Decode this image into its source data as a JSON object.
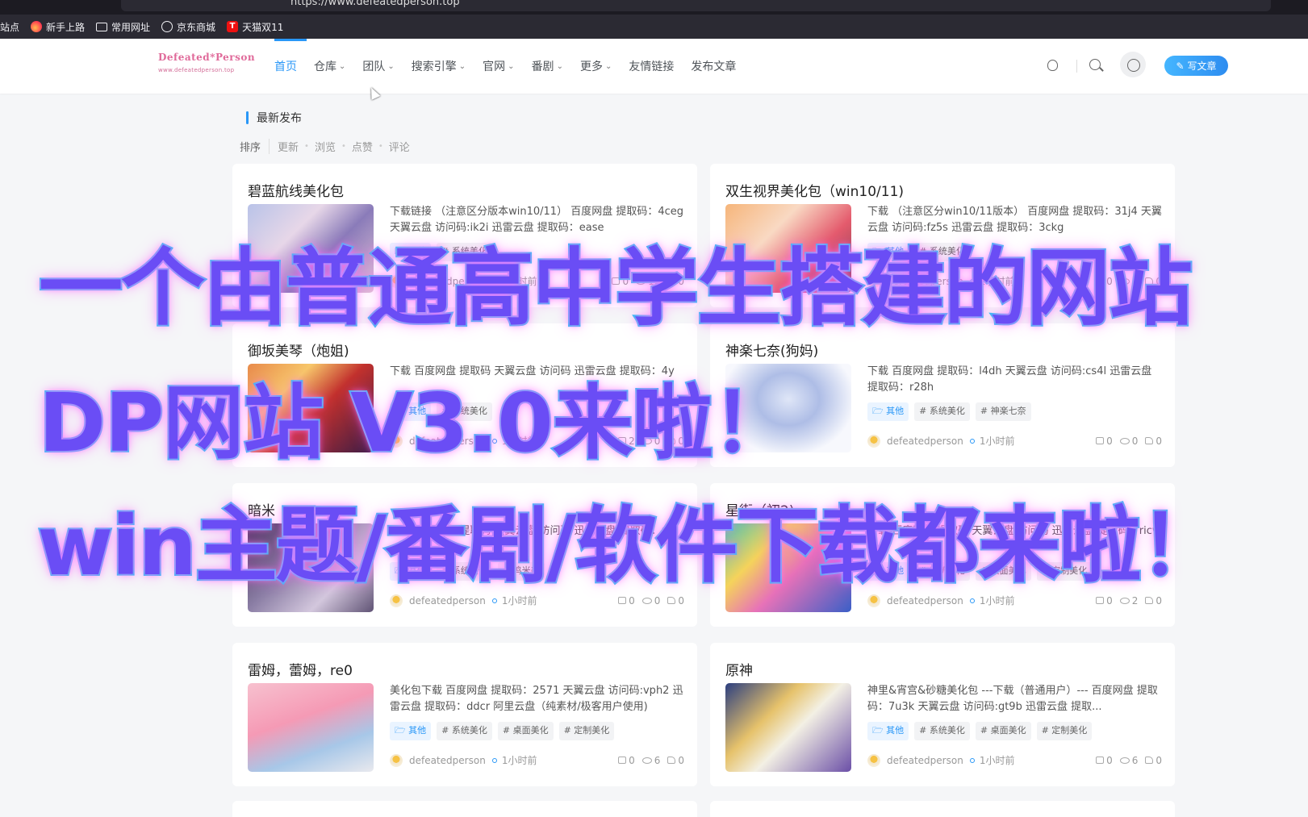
{
  "browser": {
    "url": "https://www.defeatedperson.top",
    "bookmarks": [
      {
        "label": "站点",
        "icon": "none"
      },
      {
        "label": "新手上路",
        "icon": "firefox-icon"
      },
      {
        "label": "常用网址",
        "icon": "folder-icon"
      },
      {
        "label": "京东商城",
        "icon": "globe-icon"
      },
      {
        "label": "天猫双11",
        "icon": "tmall-icon"
      }
    ]
  },
  "header": {
    "logo_text": "Defeated*Person",
    "logo_sub": "www.defeatedperson.top",
    "nav": [
      {
        "label": "首页",
        "active": true,
        "dropdown": false
      },
      {
        "label": "仓库",
        "active": false,
        "dropdown": true
      },
      {
        "label": "团队",
        "active": false,
        "dropdown": true
      },
      {
        "label": "搜索引擎",
        "active": false,
        "dropdown": true
      },
      {
        "label": "官网",
        "active": false,
        "dropdown": true
      },
      {
        "label": "番剧",
        "active": false,
        "dropdown": true
      },
      {
        "label": "更多",
        "active": false,
        "dropdown": true
      },
      {
        "label": "友情链接",
        "active": false,
        "dropdown": false
      },
      {
        "label": "发布文章",
        "active": false,
        "dropdown": false
      }
    ],
    "write_button": "写文章",
    "accent_color": "#2997f7"
  },
  "main": {
    "section_title": "最新发布",
    "sort_label": "排序",
    "sort_options": [
      "更新",
      "浏览",
      "点赞",
      "评论"
    ]
  },
  "posts": [
    {
      "title": "碧蓝航线美化包",
      "excerpt": "下载链接 （注意区分版本win10/11） 百度网盘 提取码：4ceg 天翼云盘 访问码:ik2i 迅雷云盘 提取码：ease",
      "category": "其他",
      "tags": [
        "# 系统美化"
      ],
      "author": "defeatedperson",
      "time": "1小时前",
      "comments": "0",
      "views": "12",
      "likes": "0"
    },
    {
      "title": "双生视界美化包（win10/11)",
      "excerpt": "下载 （注意区分win10/11版本） 百度网盘 提取码：31j4 天翼云盘 访问码:fz5s 迅雷云盘 提取码：3ckg",
      "category": "其他",
      "tags": [
        "# 系统美化"
      ],
      "author": "defeatedperson",
      "time": "1小时前",
      "comments": "0",
      "views": "0",
      "likes": "0"
    },
    {
      "title": "御坂美琴（炮姐)",
      "excerpt": "下载 百度网盘 提取码 天翼云盘 访问码 迅雷云盘 提取码：4y",
      "category": "其他",
      "tags": [
        "# 系统美化"
      ],
      "author": "defeatedperson",
      "time": "1小时前",
      "comments": "2",
      "views": "0",
      "likes": "0"
    },
    {
      "title": "神楽七奈(狗妈)",
      "excerpt": "下载 百度网盘 提取码：l4dh 天翼云盘 访问码:cs4l 迅雷云盘 提取码：r28h",
      "category": "其他",
      "tags": [
        "# 系统美化",
        "# 神楽七奈"
      ],
      "author": "defeatedperson",
      "time": "1小时前",
      "comments": "0",
      "views": "0",
      "likes": "0"
    },
    {
      "title": "暗米",
      "excerpt": "下载 百度网盘 提取码 天翼云盘 访问码 迅雷云盘 提取码：u8",
      "category": "其他",
      "tags": [
        "# 系统美化",
        "# 鸣米美"
      ],
      "author": "defeatedperson",
      "time": "1小时前",
      "comments": "0",
      "views": "0",
      "likes": "0"
    },
    {
      "title": "星街（初2)",
      "excerpt": "下载 百度网盘 提取码 天翼云盘 访问码 迅雷云盘 提取码：ricw",
      "category": "其他",
      "tags": [
        "# 系统美化",
        "# 桌面美化",
        "# 定制美化"
      ],
      "author": "defeatedperson",
      "time": "1小时前",
      "comments": "0",
      "views": "2",
      "likes": "0"
    },
    {
      "title": "雷姆，蕾姆，re0",
      "excerpt": "美化包下载 百度网盘 提取码：2571 天翼云盘 访问码:vph2 迅雷云盘 提取码：ddcr 阿里云盘（纯素材/极客用户使用)",
      "category": "其他",
      "tags": [
        "# 系统美化",
        "# 桌面美化",
        "# 定制美化"
      ],
      "author": "defeatedperson",
      "time": "1小时前",
      "comments": "0",
      "views": "6",
      "likes": "0"
    },
    {
      "title": "原神",
      "excerpt": "神里&宵宫&砂糖美化包 ---下载（普通用户）--- 百度网盘 提取码：7u3k 天翼云盘 访问码:gt9b 迅雷云盘 提取...",
      "category": "其他",
      "tags": [
        "# 系统美化",
        "# 桌面美化",
        "# 定制美化"
      ],
      "author": "defeatedperson",
      "time": "1小时前",
      "comments": "0",
      "views": "6",
      "likes": "0"
    }
  ],
  "overlay": {
    "line1": "一个由普通高中学生搭建的网站",
    "line2": "DP网站 V3.0来啦！",
    "line3": "win主题/番剧/软件下载都来啦！"
  }
}
